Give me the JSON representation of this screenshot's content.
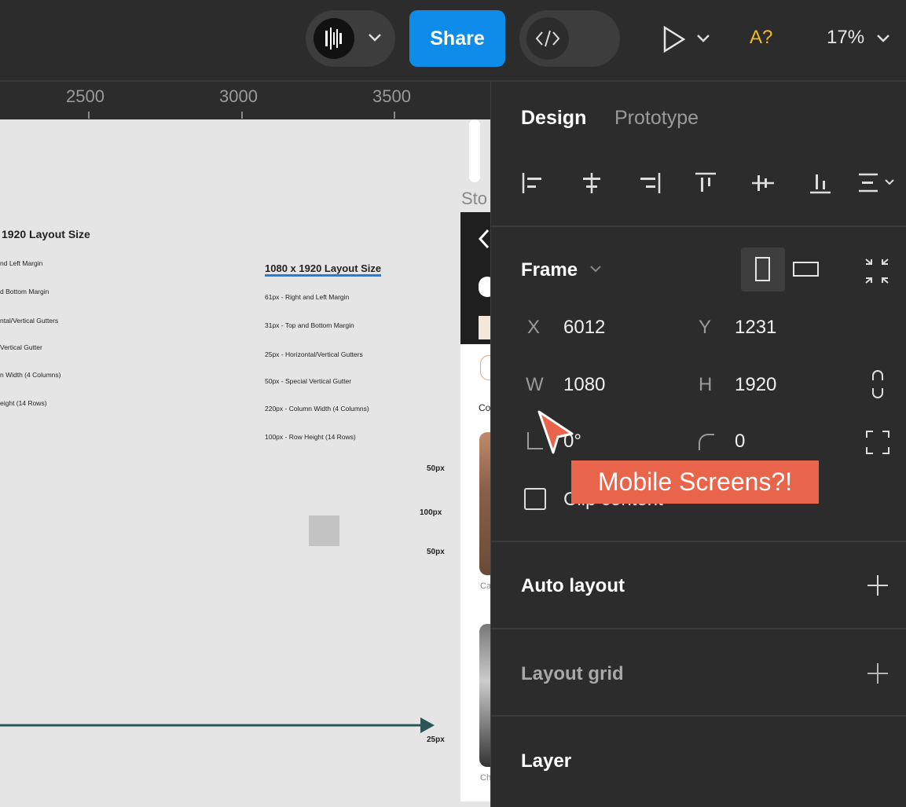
{
  "toolbar": {
    "share_label": "Share",
    "font_warning": "A?",
    "zoom_label": "17%",
    "icons": [
      "audio-bars-icon",
      "chevron-down-icon",
      "code-icon",
      "play-icon"
    ]
  },
  "ruler": {
    "labels": [
      "2500",
      "3000",
      "3500"
    ]
  },
  "canvas": {
    "left_title": "1920 Layout Size",
    "left_items": [
      "nd Left Margin",
      "d Bottom Margin",
      "ntal/Vertical Gutters",
      "Vertical Gutter",
      "n Width (4 Columns)",
      "eight (14 Rows)"
    ],
    "right_title": "1080 x 1920 Layout Size",
    "right_items": [
      "61px - Right and Left Margin",
      "31px - Top and Bottom Margin",
      "25px - Horizontal/Vertical Gutters",
      "50px - Special Vertical Gutter",
      "220px - Column Width (4 Columns)",
      "100px - Row Height (14 Rows)"
    ],
    "dims": [
      "50px",
      "100px",
      "50px",
      "25px"
    ],
    "frame_label_partial": "Sto",
    "phone_texts": [
      "Co",
      "Ca",
      "Ch"
    ]
  },
  "panel": {
    "tabs": [
      "Design",
      "Prototype"
    ],
    "frame_label": "Frame",
    "x_label": "X",
    "x_value": "6012",
    "y_label": "Y",
    "y_value": "1231",
    "w_label": "W",
    "w_value": "1080",
    "h_label": "H",
    "h_value": "1920",
    "rotation_value": "0°",
    "radius_value": "0",
    "clip_label": "Clip content",
    "auto_layout": "Auto layout",
    "layout_grid": "Layout grid",
    "layer": "Layer"
  },
  "tooltip": "Mobile Screens?!",
  "colors": {
    "accent": "#0d8ce9",
    "tooltip": "#e8644a",
    "warning": "#f3b92b"
  }
}
